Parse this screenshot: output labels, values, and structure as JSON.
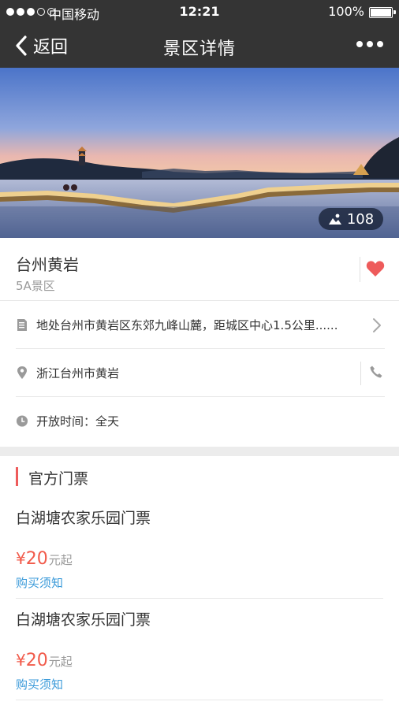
{
  "status_bar": {
    "carrier": "中国移动",
    "time": "12:21",
    "battery": "100%"
  },
  "nav": {
    "back_label": "返回",
    "title": "景区详情"
  },
  "hero": {
    "photo_count": "108"
  },
  "spot": {
    "name": "台州黄岩",
    "level": "5A景区",
    "address_desc": "地处台州市黄岩区东郊九峰山麓，距城区中心1.5公里......",
    "location": "浙江台州市黄岩",
    "hours": "开放时间：全天",
    "favorite_color": "#ee5b5b"
  },
  "tickets": {
    "section_title": "官方门票",
    "items": [
      {
        "name": "白湖塘农家乐园门票",
        "currency": "¥",
        "price": "20",
        "unit": "元起",
        "link": "购买须知"
      },
      {
        "name": "白湖塘农家乐园门票",
        "currency": "¥",
        "price": "20",
        "unit": "元起",
        "link": "购买须知"
      }
    ]
  },
  "colors": {
    "topbar": "#343434",
    "price": "#f15a4a",
    "link": "#3a9ad9",
    "accent": "#ee5b5b"
  }
}
